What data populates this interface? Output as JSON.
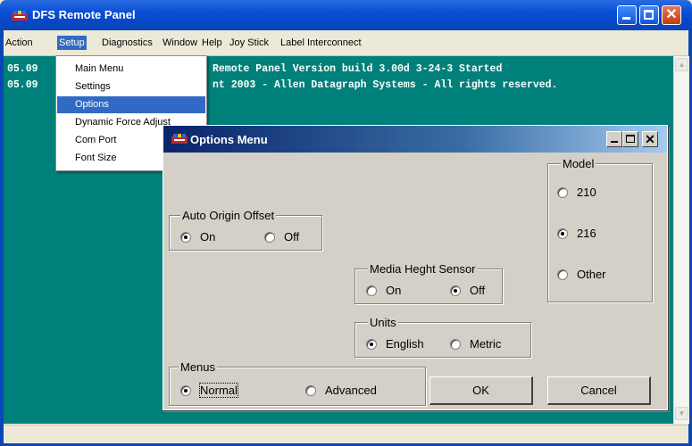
{
  "window": {
    "title": "DFS Remote Panel"
  },
  "menubar": [
    "Action",
    "Setup",
    "Diagnostics",
    "Window",
    "Help",
    "Joy Stick",
    "Label Interconnect"
  ],
  "console": {
    "lines": [
      {
        "prefix": "05.09",
        "text": "Remote Panel Version build 3.00d 3-24-3 Started"
      },
      {
        "prefix": "05.09",
        "text": "nt 2003 - Allen Datagraph Systems - All rights reserved."
      }
    ]
  },
  "setup_menu": {
    "items": [
      "Main Menu",
      "Settings",
      "Options",
      "Dynamic Force Adjust",
      "Com Port",
      "Font Size"
    ],
    "highlighted": "Options"
  },
  "dialog": {
    "title": "Options Menu",
    "auto_origin": {
      "label": "Auto Origin Offset",
      "on": "On",
      "off": "Off",
      "selected": "On"
    },
    "media_sensor": {
      "label": "Media Heght Sensor",
      "on": "On",
      "off": "Off",
      "selected": "Off"
    },
    "units": {
      "label": "Units",
      "english": "English",
      "metric": "Metric",
      "selected": "English"
    },
    "menus": {
      "label": "Menus",
      "normal": "Normal",
      "advanced": "Advanced",
      "selected": "Normal"
    },
    "model": {
      "label": "Model",
      "options": [
        "210",
        "216",
        "Other"
      ],
      "selected": "216"
    },
    "ok_label": "OK",
    "cancel_label": "Cancel"
  }
}
